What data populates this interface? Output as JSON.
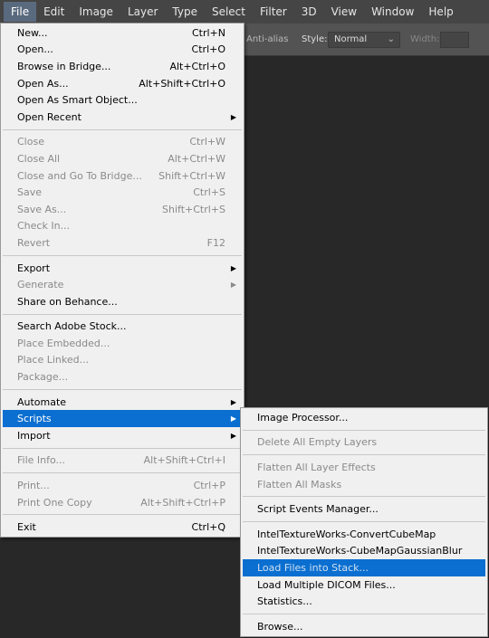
{
  "menubar": [
    "File",
    "Edit",
    "Image",
    "Layer",
    "Type",
    "Select",
    "Filter",
    "3D",
    "View",
    "Window",
    "Help"
  ],
  "options": {
    "anti_alias": "Anti-alias",
    "style_label": "Style:",
    "style_value": "Normal",
    "width_label": "Width:"
  },
  "file_menu": [
    {
      "label": "New...",
      "shortcut": "Ctrl+N"
    },
    {
      "label": "Open...",
      "shortcut": "Ctrl+O"
    },
    {
      "label": "Browse in Bridge...",
      "shortcut": "Alt+Ctrl+O"
    },
    {
      "label": "Open As...",
      "shortcut": "Alt+Shift+Ctrl+O"
    },
    {
      "label": "Open As Smart Object..."
    },
    {
      "label": "Open Recent",
      "submenu": true
    },
    {
      "sep": true
    },
    {
      "label": "Close",
      "shortcut": "Ctrl+W",
      "disabled": true
    },
    {
      "label": "Close All",
      "shortcut": "Alt+Ctrl+W",
      "disabled": true
    },
    {
      "label": "Close and Go To Bridge...",
      "shortcut": "Shift+Ctrl+W",
      "disabled": true
    },
    {
      "label": "Save",
      "shortcut": "Ctrl+S",
      "disabled": true
    },
    {
      "label": "Save As...",
      "shortcut": "Shift+Ctrl+S",
      "disabled": true
    },
    {
      "label": "Check In...",
      "disabled": true
    },
    {
      "label": "Revert",
      "shortcut": "F12",
      "disabled": true
    },
    {
      "sep": true
    },
    {
      "label": "Export",
      "submenu": true
    },
    {
      "label": "Generate",
      "submenu": true,
      "disabled": true
    },
    {
      "label": "Share on Behance..."
    },
    {
      "sep": true
    },
    {
      "label": "Search Adobe Stock..."
    },
    {
      "label": "Place Embedded...",
      "disabled": true
    },
    {
      "label": "Place Linked...",
      "disabled": true
    },
    {
      "label": "Package...",
      "disabled": true
    },
    {
      "sep": true
    },
    {
      "label": "Automate",
      "submenu": true
    },
    {
      "label": "Scripts",
      "submenu": true,
      "highlighted": true
    },
    {
      "label": "Import",
      "submenu": true
    },
    {
      "sep": true
    },
    {
      "label": "File Info...",
      "shortcut": "Alt+Shift+Ctrl+I",
      "disabled": true
    },
    {
      "sep": true
    },
    {
      "label": "Print...",
      "shortcut": "Ctrl+P",
      "disabled": true
    },
    {
      "label": "Print One Copy",
      "shortcut": "Alt+Shift+Ctrl+P",
      "disabled": true
    },
    {
      "sep": true
    },
    {
      "label": "Exit",
      "shortcut": "Ctrl+Q"
    }
  ],
  "scripts_menu": [
    {
      "label": "Image Processor..."
    },
    {
      "sep": true
    },
    {
      "label": "Delete All Empty Layers",
      "disabled": true
    },
    {
      "sep": true
    },
    {
      "label": "Flatten All Layer Effects",
      "disabled": true
    },
    {
      "label": "Flatten All Masks",
      "disabled": true
    },
    {
      "sep": true
    },
    {
      "label": "Script Events Manager..."
    },
    {
      "sep": true
    },
    {
      "label": "IntelTextureWorks-ConvertCubeMap"
    },
    {
      "label": "IntelTextureWorks-CubeMapGaussianBlur"
    },
    {
      "label": "Load Files into Stack...",
      "highlighted": true,
      "disabled": true
    },
    {
      "label": "Load Multiple DICOM Files..."
    },
    {
      "label": "Statistics..."
    },
    {
      "sep": true
    },
    {
      "label": "Browse..."
    }
  ],
  "colors": {
    "highlight": "#0a6fd0",
    "menu_bg": "#f0f0f0",
    "canvas": "#282828"
  }
}
